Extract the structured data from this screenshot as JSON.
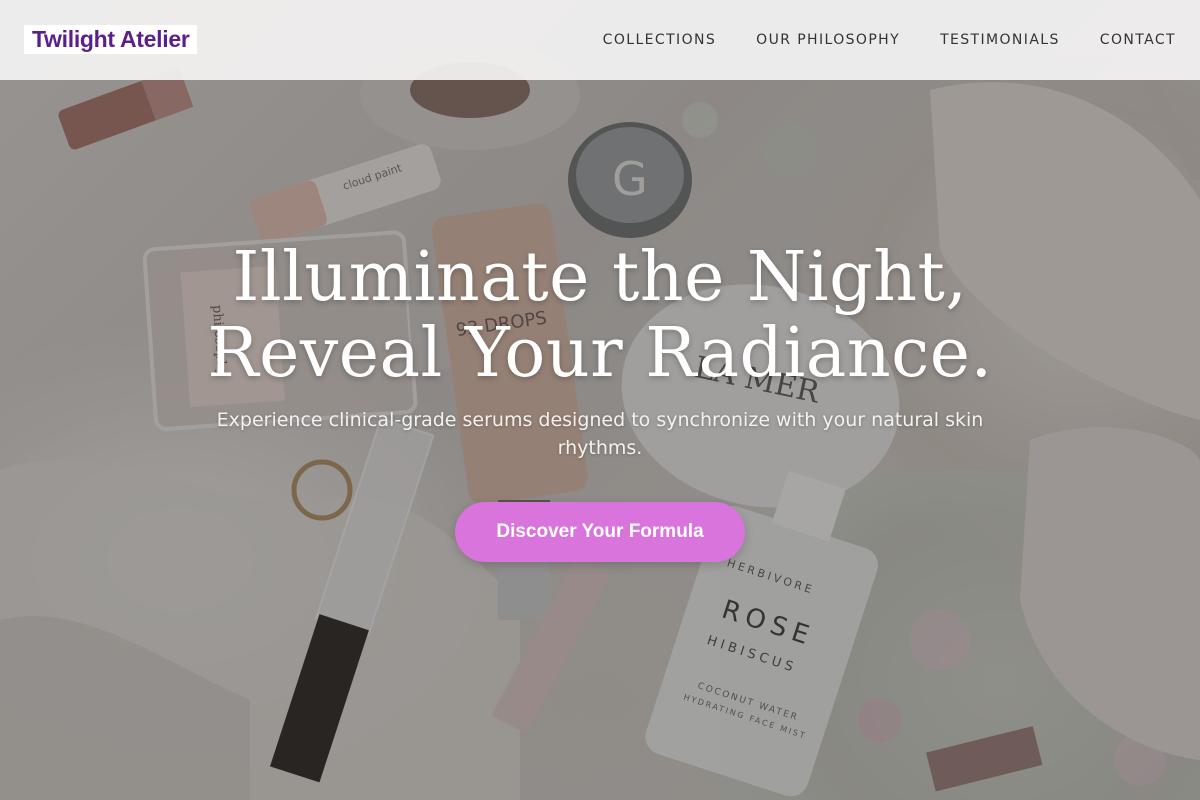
{
  "brand": {
    "logo_text": "Twilight Atelier",
    "logo_color": "#5a1f8a"
  },
  "nav": {
    "items": [
      {
        "label": "COLLECTIONS"
      },
      {
        "label": "OUR PHILOSOPHY"
      },
      {
        "label": "TESTIMONIALS"
      },
      {
        "label": "CONTACT"
      }
    ]
  },
  "hero": {
    "title_line1": "Illuminate the Night,",
    "title_line2": "Reveal Your Radiance.",
    "subtitle": "Experience clinical-grade serums designed to synchronize with your natural skin rhythms.",
    "cta_label": "Discover Your Formula",
    "cta_color": "#d874dc"
  },
  "background_photo": {
    "labels": {
      "philosophy": "philosophy",
      "cloud_paint": "cloud paint",
      "drops": "93 DROPS",
      "lamer": "LA MER",
      "herbivore": "HERBIVORE",
      "rose": "ROSE",
      "hibiscus": "HIBISCUS",
      "coconut": "COCONUT WATER",
      "mist": "HYDRATING FACE MIST"
    }
  }
}
